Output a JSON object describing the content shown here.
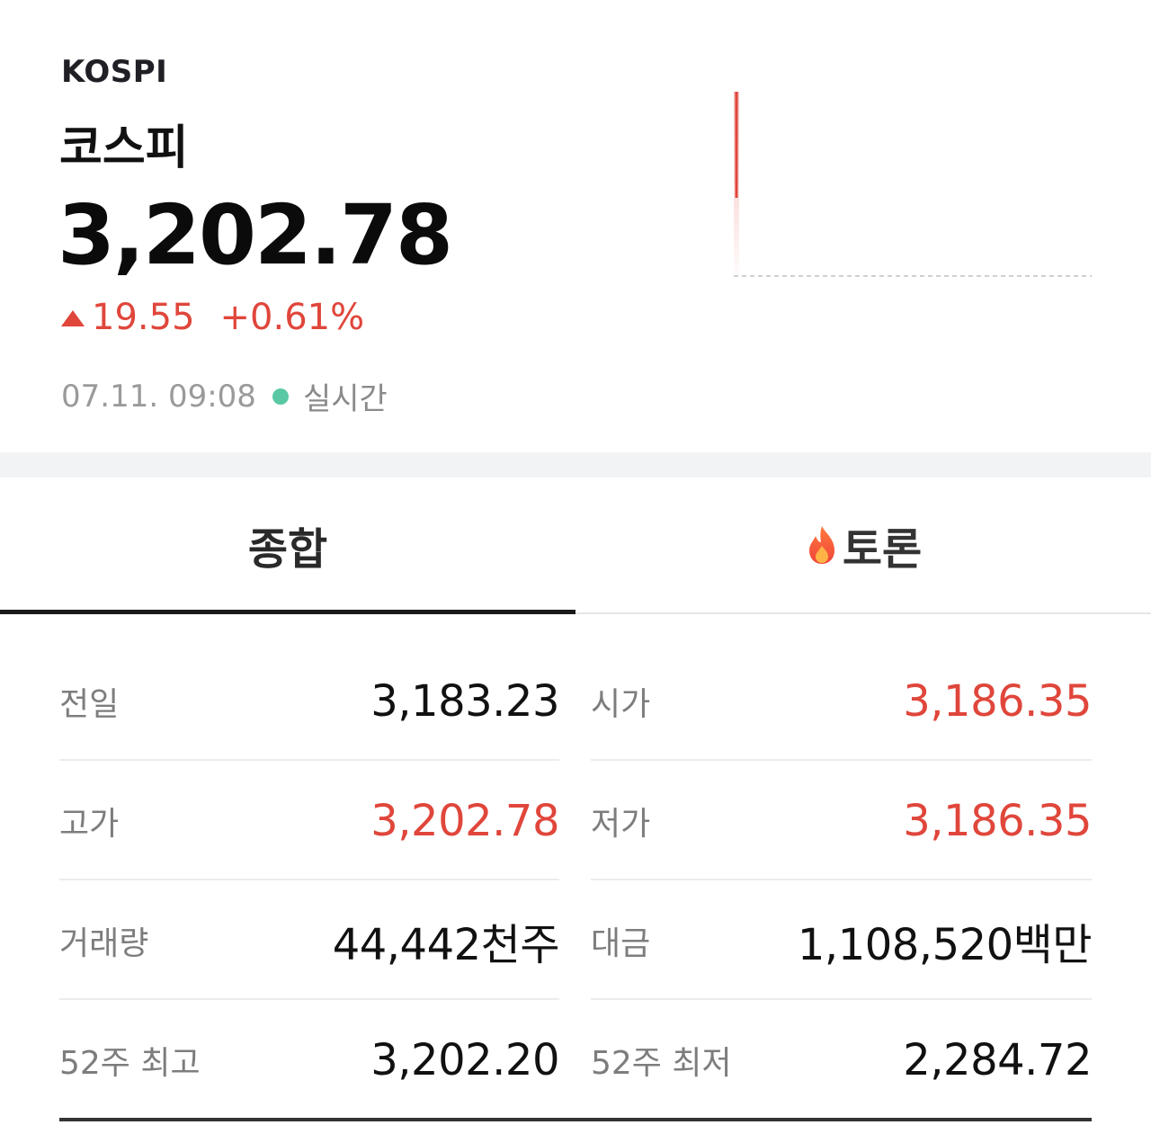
{
  "header": {
    "code": "KOSPI",
    "name": "코스피",
    "price": "3,202.78",
    "change": "19.55",
    "change_pct": "+0.61%",
    "timestamp": "07.11. 09:08",
    "live_label": "실시간"
  },
  "colors": {
    "up": "#e0463b",
    "live": "#5ac8a5",
    "text": "#111111",
    "muted": "#7d7d7d"
  },
  "tabs": [
    {
      "label": "종합",
      "active": true
    },
    {
      "label": "토론",
      "icon": "fire-icon",
      "active": false
    }
  ],
  "stats": {
    "prev_close": {
      "label": "전일",
      "value": "3,183.23"
    },
    "open": {
      "label": "시가",
      "value": "3,186.35"
    },
    "high": {
      "label": "고가",
      "value": "3,202.78"
    },
    "low": {
      "label": "저가",
      "value": "3,186.35"
    },
    "volume": {
      "label": "거래량",
      "value": "44,442천주"
    },
    "amount": {
      "label": "대금",
      "value": "1,108,520백만"
    },
    "high52": {
      "label": "52주 최고",
      "value": "3,202.20"
    },
    "low52": {
      "label": "52주 최저",
      "value": "2,284.72"
    }
  }
}
